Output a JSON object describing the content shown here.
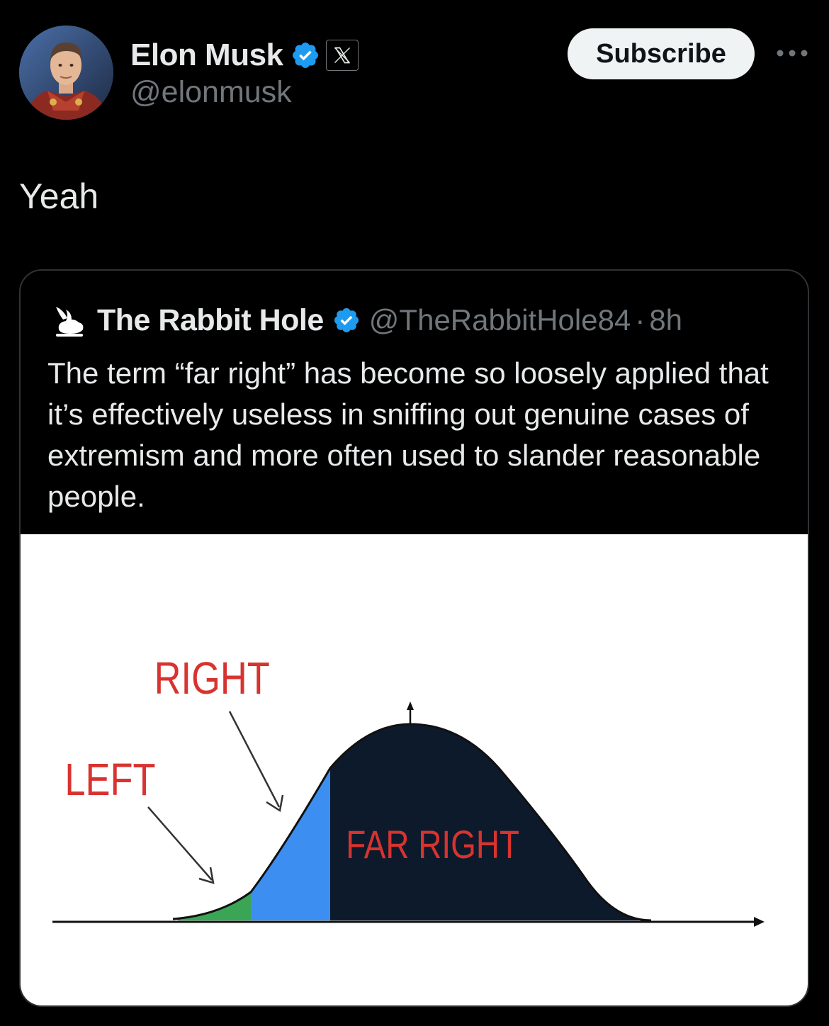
{
  "author": {
    "name": "Elon Musk",
    "handle": "@elonmusk",
    "verified_icon": "verified-badge-icon",
    "affiliate_icon": "x-logo-icon"
  },
  "actions": {
    "subscribe_label": "Subscribe",
    "more_icon": "more-options-icon"
  },
  "tweet": {
    "text": "Yeah"
  },
  "quoted_tweet": {
    "author_name": "The Rabbit Hole",
    "author_handle": "@TheRabbitHole84",
    "separator": "·",
    "time": "8h",
    "avatar_icon": "rabbit-icon",
    "text": "The term “far right” has become so loosely applied that it’s effectively useless in sniffing out genuine cases of extremism and more often used to slander reasonable people.",
    "image": {
      "labels": {
        "left": "LEFT",
        "right": "RIGHT",
        "far_right": "FAR RIGHT"
      },
      "colors": {
        "left": "#3aa655",
        "right": "#3c8ff0",
        "far_right": "#0d1a2c",
        "label_text": "#d8332f"
      }
    }
  },
  "colors": {
    "background": "#000000",
    "text_primary": "#e7e9ea",
    "text_secondary": "#71767b",
    "verified_blue": "#1d9bf0",
    "card_border": "#2f3336"
  }
}
